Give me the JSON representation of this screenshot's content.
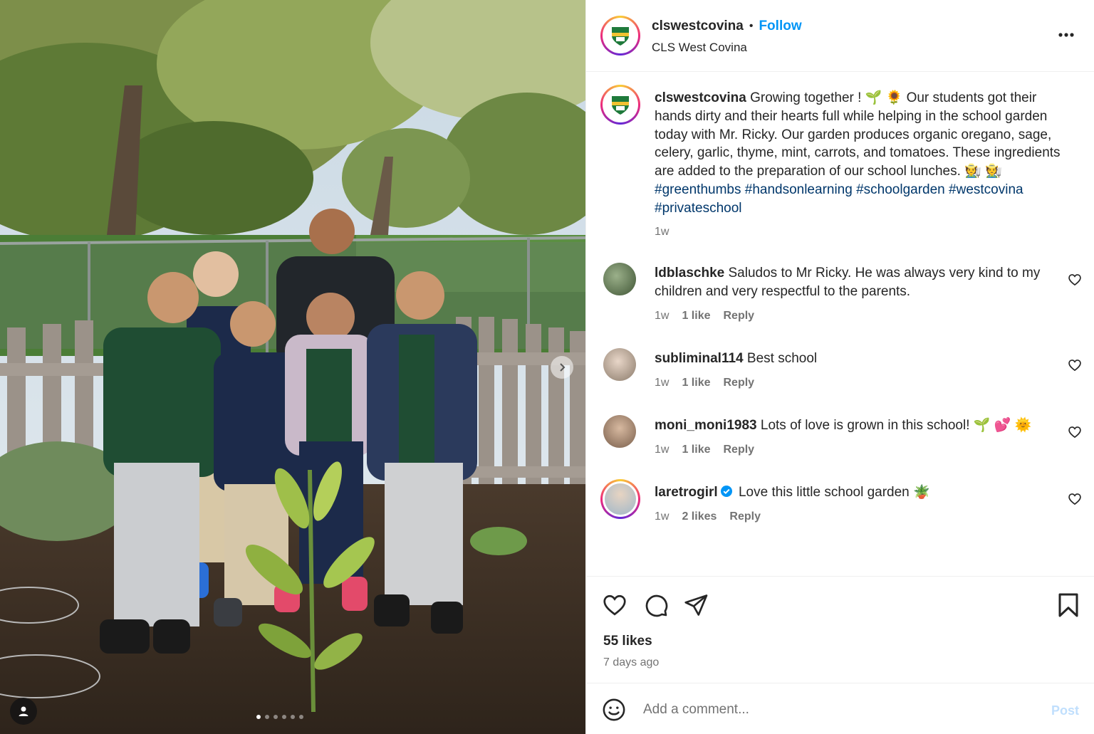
{
  "post": {
    "username": "clswestcovina",
    "bullet": "•",
    "follow_label": "Follow",
    "location": "CLS West Covina",
    "more_label": "More options"
  },
  "caption": {
    "username": "clswestcovina",
    "text_1": "Growing together ! 🌱 🌻 Our students got their hands dirty and their hearts full while helping in the school garden today with Mr. Ricky. Our garden produces organic oregano, sage, celery, garlic, thyme, mint, carrots, and tomatoes. These ingredients are added to the preparation of our school lunches. 🧑‍🌾 🧑‍🌾 ",
    "hashtags": "#greenthumbs #handsonlearning #schoolgarden #westcovina #privateschool",
    "time": "1w"
  },
  "comments": [
    {
      "username": "ldblaschke",
      "text": "Saludos to Mr Ricky. He was always very kind to my children and very respectful to the parents.",
      "time": "1w",
      "likes": "1 like",
      "reply": "Reply",
      "verified": false
    },
    {
      "username": "subliminal114",
      "text": "Best school",
      "time": "1w",
      "likes": "1 like",
      "reply": "Reply",
      "verified": false
    },
    {
      "username": "moni_moni1983",
      "text": "Lots of love is grown in this school! 🌱 💕 🌞",
      "time": "1w",
      "likes": "1 like",
      "reply": "Reply",
      "verified": false
    },
    {
      "username": "laretrogirl",
      "text": "Love this little school garden 🪴",
      "time": "1w",
      "likes": "2 likes",
      "reply": "Reply",
      "verified": true
    }
  ],
  "engagement": {
    "likes": "55 likes",
    "posted": "7 days ago"
  },
  "composer": {
    "placeholder": "Add a comment...",
    "post_label": "Post"
  },
  "icons": {
    "like": "heart-icon",
    "comment": "comment-bubble-icon",
    "share": "paper-plane-icon",
    "save": "bookmark-icon",
    "emoji": "smiley-icon",
    "more": "ellipsis-icon",
    "next": "chevron-right-icon",
    "tag": "user-tag-icon"
  },
  "colors": {
    "link": "#0095f6",
    "hashtag": "#00376b",
    "muted": "#737373",
    "uniform_green": "#1f4d33",
    "uniform_navy": "#1c2a4a"
  },
  "carousel": {
    "slides": 6,
    "active": 1
  }
}
